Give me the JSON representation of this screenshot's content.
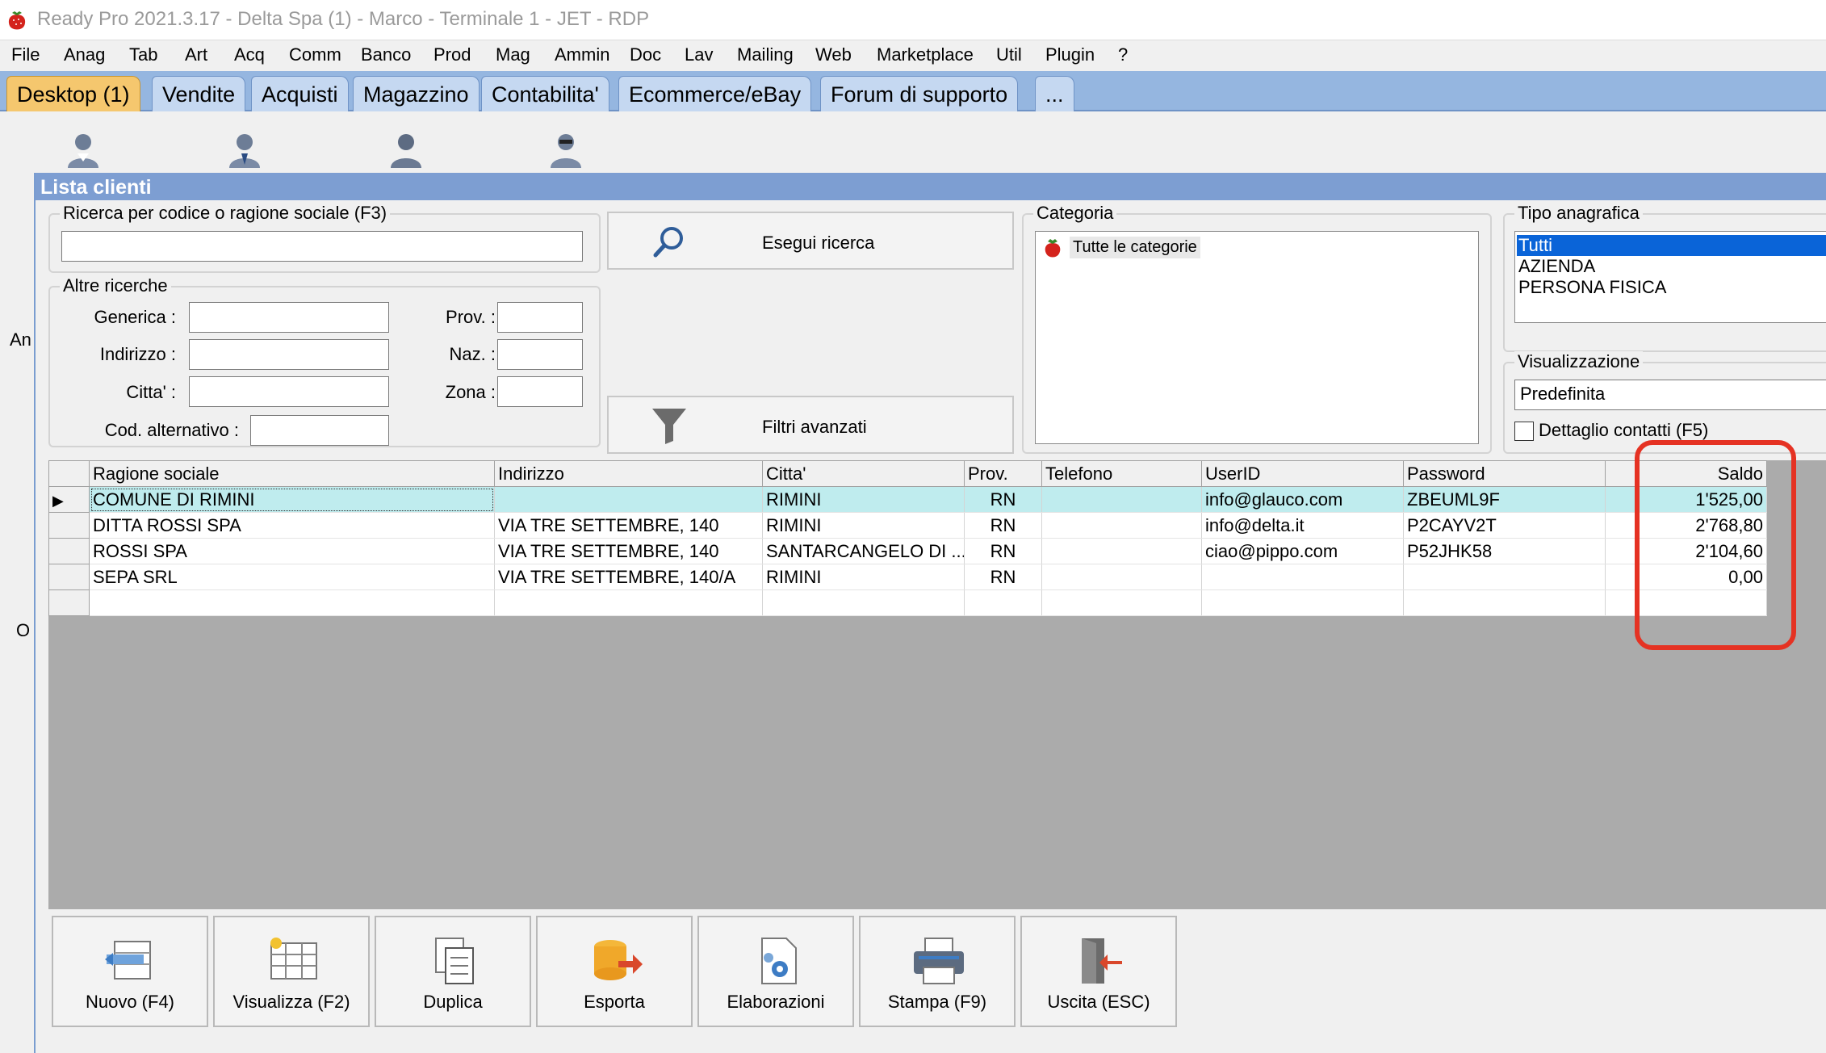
{
  "titlebar": {
    "title": "Ready Pro 2021.3.17 - Delta Spa (1) - Marco - Terminale 1 - JET - RDP"
  },
  "menu": [
    "File",
    "Anag",
    "Tab",
    "Art",
    "Acq",
    "Comm",
    "Banco",
    "Prod",
    "Mag",
    "Ammin",
    "Doc",
    "Lav",
    "Mailing",
    "Web",
    "Marketplace",
    "Util",
    "Plugin",
    "?"
  ],
  "tabs": [
    "Desktop (1)",
    "Vendite",
    "Acquisti",
    "Magazzino",
    "Contabilita'",
    "Ecommerce/eBay",
    "Forum di supporto",
    "..."
  ],
  "side_cut": [
    "An",
    "O"
  ],
  "window": {
    "title": "Lista clienti",
    "search": {
      "legend": "Ricerca per codice o ragione sociale (F3)",
      "value": "",
      "button": "Esegui ricerca"
    },
    "other": {
      "legend": "Altre ricerche",
      "generica": "Generica :",
      "indirizzo": "Indirizzo :",
      "citta": "Citta' :",
      "cod_alt": "Cod. alternativo :",
      "prov": "Prov. :",
      "naz": "Naz. :",
      "zona": "Zona :"
    },
    "filters_button": "Filtri avanzati",
    "categoria": {
      "legend": "Categoria",
      "item": "Tutte le categorie"
    },
    "tipo": {
      "legend": "Tipo anagrafica",
      "options": [
        "Tutti",
        "AZIENDA",
        "PERSONA FISICA"
      ],
      "selected": "Tutti"
    },
    "visualizzazione": {
      "legend": "Visualizzazione",
      "value": "Predefinita"
    },
    "dettaglio": "Dettaglio contatti (F5)"
  },
  "table": {
    "headers": [
      "Ragione sociale",
      "Indirizzo",
      "Citta'",
      "Prov.",
      "Telefono",
      "UserID",
      "Password",
      "Saldo"
    ],
    "rows": [
      [
        "COMUNE DI RIMINI",
        "",
        "RIMINI",
        "RN",
        "",
        "info@glauco.com",
        "ZBEUML9F",
        "1'525,00"
      ],
      [
        "DITTA ROSSI SPA",
        "VIA TRE SETTEMBRE, 140",
        "RIMINI",
        "RN",
        "",
        "info@delta.it",
        "P2CAYV2T",
        "2'768,80"
      ],
      [
        "ROSSI SPA",
        "VIA TRE SETTEMBRE, 140",
        "SANTARCANGELO DI ...",
        "RN",
        "",
        "ciao@pippo.com",
        "P52JHK58",
        "2'104,60"
      ],
      [
        "SEPA SRL",
        "VIA TRE SETTEMBRE, 140/A",
        "RIMINI",
        "RN",
        "",
        "",
        "",
        "0,00"
      ]
    ]
  },
  "toolbar": [
    "Nuovo (F4)",
    "Visualizza (F2)",
    "Duplica",
    "Esporta",
    "Elaborazioni",
    "Stampa (F9)",
    "Uscita (ESC)"
  ],
  "colors": {
    "tabbar": "#95b6e0",
    "active_tab": "#f5c76e",
    "selected_row": "#bfecee",
    "highlight": "#e53223"
  }
}
